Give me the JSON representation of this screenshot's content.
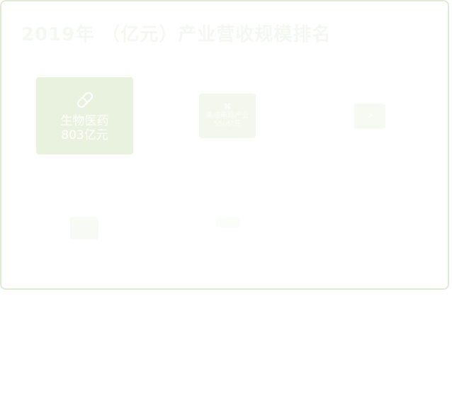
{
  "title": "2019年 （亿元）产业营收规模排名",
  "tiles": [
    {
      "icon": "pill-icon",
      "name": "生物医药",
      "value": "803亿元"
    },
    {
      "icon": "chip-icon",
      "name": "集成电路产业",
      "value": "550亿元"
    },
    {
      "icon": "arrow-icon",
      "name": "",
      "value": ""
    },
    {
      "icon": "",
      "name": "",
      "value": ""
    },
    {
      "icon": "",
      "name": "",
      "value": ""
    }
  ],
  "colors": {
    "border": "#e0ebd7",
    "tile_primary": "#e9f2df",
    "tile_faded": "#f3f7ee",
    "text": "#ffffff"
  }
}
